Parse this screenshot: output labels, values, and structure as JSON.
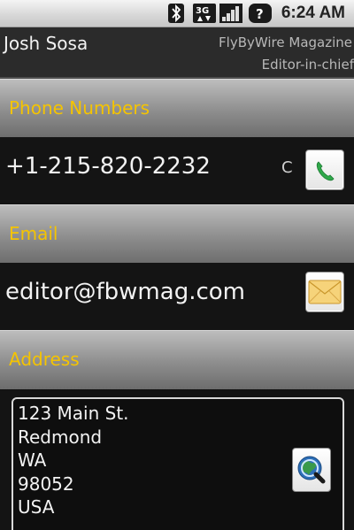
{
  "status_bar": {
    "time": "6:24 AM",
    "network": "3G",
    "icons": [
      "bluetooth-icon",
      "3g-data-icon",
      "signal-icon",
      "unknown-notification-icon"
    ]
  },
  "contact": {
    "name": "Josh Sosa",
    "company": "FlyByWire Magazine",
    "title": "Editor-in-chief"
  },
  "sections": {
    "phone": {
      "heading": "Phone Numbers",
      "number": "+1-215-820-2232",
      "type": "C",
      "action_icon": "phone-icon"
    },
    "email": {
      "heading": "Email",
      "address": "editor@fbwmag.com",
      "action_icon": "envelope-icon"
    },
    "address": {
      "heading": "Address",
      "lines": [
        "123 Main St.",
        "Redmond",
        "WA",
        "98052",
        "USA"
      ],
      "action_icon": "map-search-icon"
    }
  },
  "colors": {
    "section_heading": "#f5c400",
    "background": "#141414",
    "header": "#2b2b2b"
  }
}
